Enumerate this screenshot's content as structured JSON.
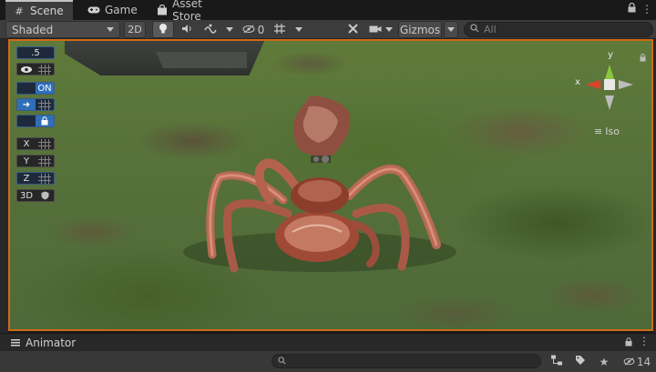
{
  "tabs": [
    {
      "label": "Scene",
      "icon": "hash-icon",
      "active": true
    },
    {
      "label": "Game",
      "icon": "gamepad-icon",
      "active": false
    },
    {
      "label": "Asset Store",
      "icon": "bag-icon",
      "active": false
    }
  ],
  "toolbar": {
    "shading_mode": "Shaded",
    "mode_2d": "2D",
    "hidden_count": "0",
    "gizmos_label": "Gizmos",
    "search_placeholder": "All"
  },
  "overlay": {
    "snap_value": ".5",
    "on_label": "ON",
    "x_label": "X",
    "y_label": "Y",
    "z_label": "Z",
    "three_d_label": "3D"
  },
  "gizmo": {
    "y_axis": "y",
    "x_axis": "x",
    "projection": "Iso"
  },
  "animator": {
    "title": "Animator",
    "visible_layers": "14"
  },
  "colors": {
    "accent_orange": "#d06a17",
    "selection_blue": "#2f6fb8",
    "axis_x": "#e0402a",
    "axis_y": "#8cc63f",
    "panel_bg": "#3c3c3c"
  }
}
